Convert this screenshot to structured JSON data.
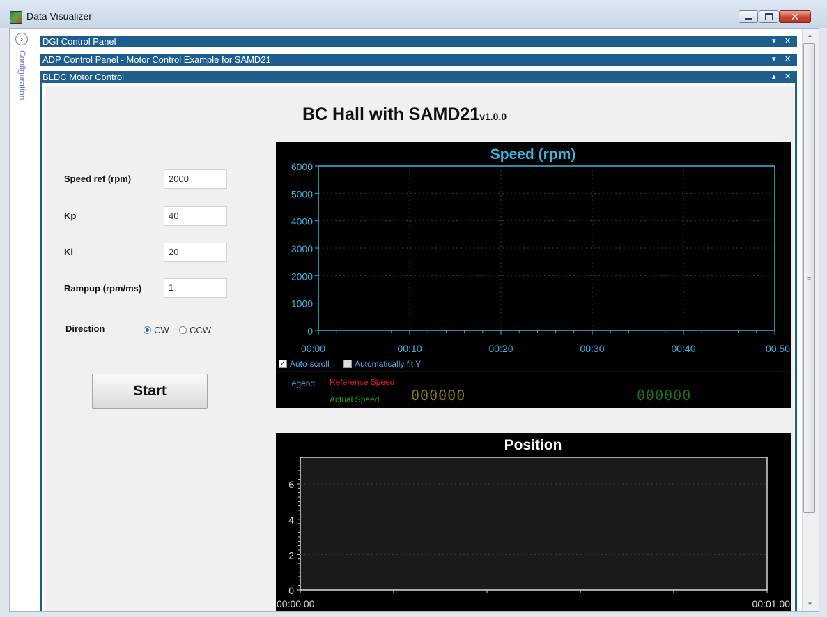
{
  "window": {
    "title": "Data Visualizer"
  },
  "sidebar": {
    "label": "Configuration"
  },
  "panels": {
    "dgi": {
      "title": "DGI Control Panel",
      "ctrl": "▾",
      "close": "✕"
    },
    "adp": {
      "title": "ADP Control Panel - Motor Control Example for SAMD21",
      "ctrl": "▾",
      "close": "✕"
    },
    "bldc": {
      "title": "BLDC Motor Control",
      "ctrl": "▴",
      "close": "✕"
    }
  },
  "app": {
    "heading": "BC Hall with SAMD21",
    "version": "v1.0.0"
  },
  "params": {
    "speed_ref": {
      "label": "Speed ref (rpm)",
      "value": "2000"
    },
    "kp": {
      "label": "Kp",
      "value": "40"
    },
    "ki": {
      "label": "Ki",
      "value": "20"
    },
    "rampup": {
      "label": "Rampup (rpm/ms)",
      "value": "1"
    }
  },
  "direction": {
    "label": "Direction",
    "options": [
      "CW",
      "CCW"
    ],
    "selected": "CW"
  },
  "start_button": {
    "label": "Start"
  },
  "speed_chart": {
    "title": "Speed (rpm)",
    "y_ticks": [
      "0",
      "1000",
      "2000",
      "3000",
      "4000",
      "5000",
      "6000"
    ],
    "x_ticks": [
      "00:00",
      "00:10",
      "00:20",
      "00:30",
      "00:40",
      "00:50"
    ],
    "auto_scroll": {
      "label": "Auto-scroll",
      "checked": true
    },
    "auto_fit": {
      "label": "Automatically fit Y",
      "checked": false
    },
    "legend": {
      "label": "Legend",
      "reference": "Reference Speed",
      "actual": "Actual Speed",
      "reference_readout": "000000",
      "actual_readout": "000000"
    },
    "colors": {
      "axis": "#3ab4e0",
      "title": "#3ab4e0",
      "reference": "#e02020",
      "actual": "#1fa62a",
      "readout_ref": "#8a7a18",
      "readout_act": "#1b6b20"
    }
  },
  "position_chart": {
    "title": "Position",
    "y_ticks": [
      "0",
      "2",
      "4",
      "6"
    ],
    "x_start": "00:00.00",
    "x_end": "00:01.00"
  }
}
